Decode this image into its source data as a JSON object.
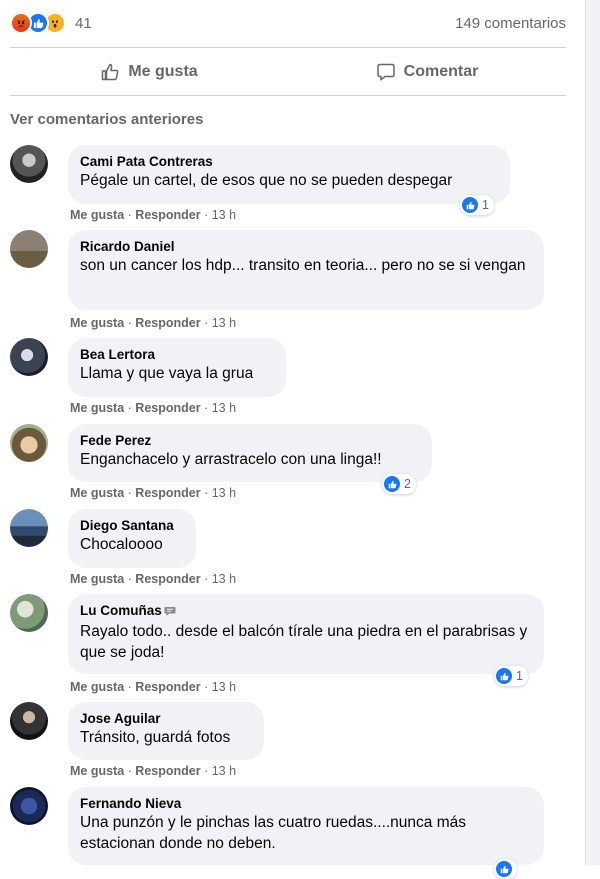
{
  "post_stats": {
    "reaction_count": "41",
    "comments_count": "149 comentarios",
    "reactions": [
      "angry-icon",
      "like-icon",
      "wow-icon"
    ]
  },
  "actions": {
    "like_label": "Me gusta",
    "comment_label": "Comentar"
  },
  "previous_comments_label": "Ver comentarios anteriores",
  "comment_meta": {
    "like": "Me gusta",
    "reply": "Responder",
    "time": "13 h"
  },
  "comments": [
    {
      "author": "Cami Pata Contreras",
      "text": "Pégale un cartel, de esos que no se pueden despegar",
      "likes": "1"
    },
    {
      "author": "Ricardo Daniel",
      "text": "son un cancer los hdp... transito en teoria... pero no se si vengan",
      "likes": ""
    },
    {
      "author": "Bea Lertora",
      "text": "Llama y que vaya la grua",
      "likes": ""
    },
    {
      "author": "Fede Perez",
      "text": "Enganchacelo y arrastracelo con una linga!!",
      "likes": "2"
    },
    {
      "author": "Diego Santana",
      "text": "Chocaloooo",
      "likes": ""
    },
    {
      "author": "Lu Comuñas",
      "text": "Rayalo todo.. desde el balcón tírale una piedra en el parabrisas y que se joda!",
      "likes": "1"
    },
    {
      "author": "Jose Aguilar",
      "text": "Tránsito, guardá fotos",
      "likes": ""
    },
    {
      "author": "Fernando Nieva",
      "text": "Una punzón y le pinchas las cuatro ruedas....nunca más estacionan donde no deben.",
      "likes": ""
    }
  ],
  "colors": {
    "link_blue": "#1877f2",
    "muted_text": "#65676b",
    "bubble_bg": "#f0f2f5"
  }
}
